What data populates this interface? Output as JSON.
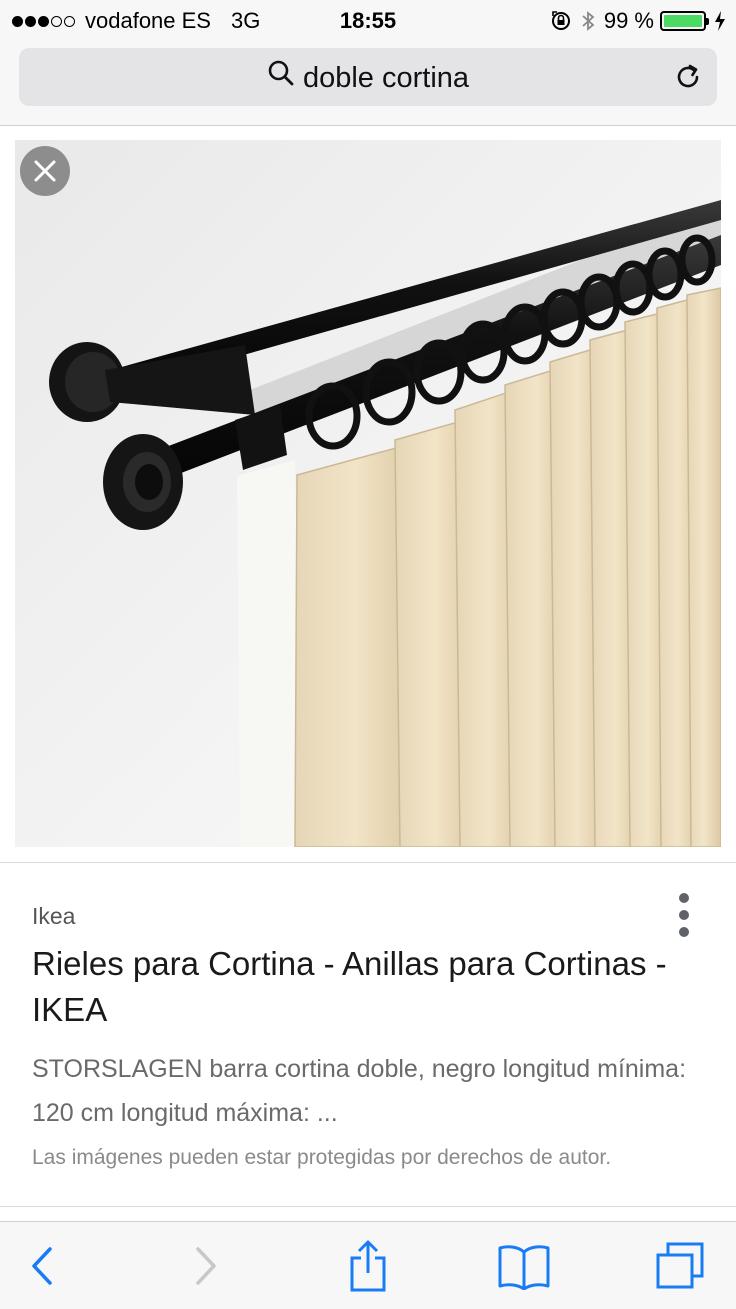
{
  "status_bar": {
    "signal_dots_filled": 3,
    "signal_dots_total": 5,
    "carrier": "vodafone ES",
    "network": "3G",
    "time": "18:55",
    "battery_percent": "99 %",
    "battery_level": 0.99,
    "icons": [
      "orientation-lock-icon",
      "bluetooth-icon",
      "battery-icon",
      "charging-bolt-icon"
    ]
  },
  "url_bar": {
    "text": "doble cortina",
    "icons": [
      "search-icon",
      "reload-icon"
    ]
  },
  "image_viewer": {
    "close_icon": "close-icon",
    "image_description_icon": "curtain-rod-photo"
  },
  "result": {
    "source": "Ikea",
    "title": "Rieles para Cortina - Anillas para Cortinas - IKEA",
    "snippet": "STORSLAGEN barra cortina doble, negro longitud mínima: 120 cm longitud máxima: ...",
    "copyright": "Las imágenes pueden estar protegidas por derechos de autor.",
    "menu_icon": "more-vertical-icon"
  },
  "toolbar": {
    "icons": [
      "back-icon",
      "forward-icon",
      "share-icon",
      "bookmarks-icon",
      "tabs-icon"
    ]
  },
  "colors": {
    "accent": "#1a7cf5",
    "battery": "#4cd964",
    "disabled": "#c7c7cc"
  }
}
